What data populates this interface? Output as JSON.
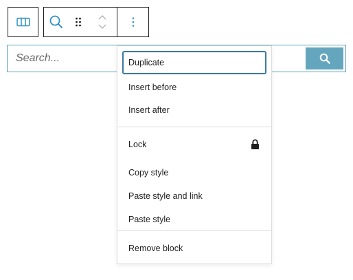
{
  "search": {
    "placeholder": "Search..."
  },
  "menu": {
    "section1": [
      "Duplicate",
      "Insert before",
      "Insert after"
    ],
    "section2": [
      "Lock",
      "Copy style",
      "Paste style and link",
      "Paste style"
    ],
    "section3": [
      "Remove block"
    ]
  },
  "icons": {
    "block_type": "columns-icon",
    "search_block": "search-icon",
    "drag": "drag-handle-icon",
    "move": "chevron-up-down-icon",
    "options": "more-vertical-icon",
    "lock": "lock-icon",
    "search_button": "search-icon"
  },
  "colors": {
    "accent": "#2f8fc4",
    "search_button": "#64a6bd",
    "focus_border": "#3a7aa0",
    "input_border": "#5ba4bb"
  }
}
